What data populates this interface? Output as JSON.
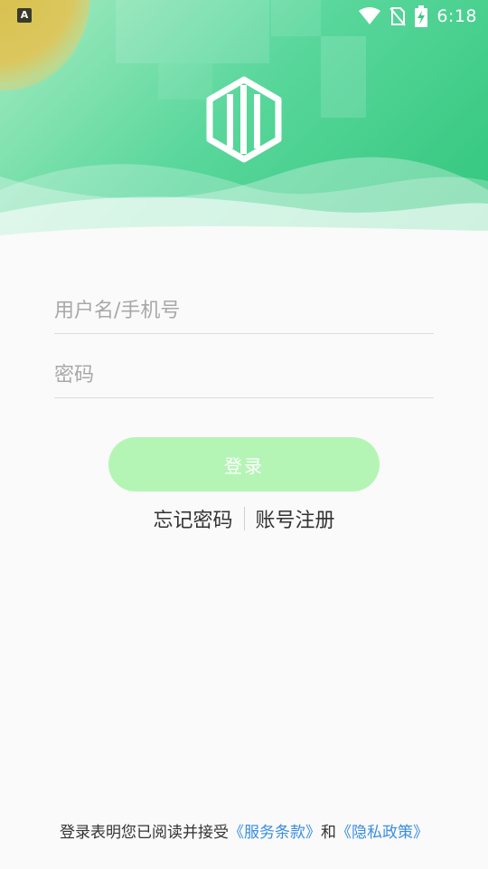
{
  "status_bar": {
    "app_indicator": "A",
    "time": "6:18",
    "icons": [
      "wifi-icon",
      "no-sim-icon",
      "battery-charging-icon"
    ]
  },
  "header": {
    "logo": "building-logo-icon"
  },
  "form": {
    "username_placeholder": "用户名/手机号",
    "password_placeholder": "密码",
    "login_label": "登录"
  },
  "links": {
    "forgot_password": "忘记密码",
    "register": "账号注册"
  },
  "footer": {
    "prefix": "登录表明您已阅读并接受",
    "terms": "《服务条款》",
    "conjunction": "和",
    "privacy": "《隐私政策》"
  },
  "colors": {
    "brand_green": "#2ec57a",
    "button_bg": "#b4f5b5",
    "link_blue": "#3b8ede"
  }
}
